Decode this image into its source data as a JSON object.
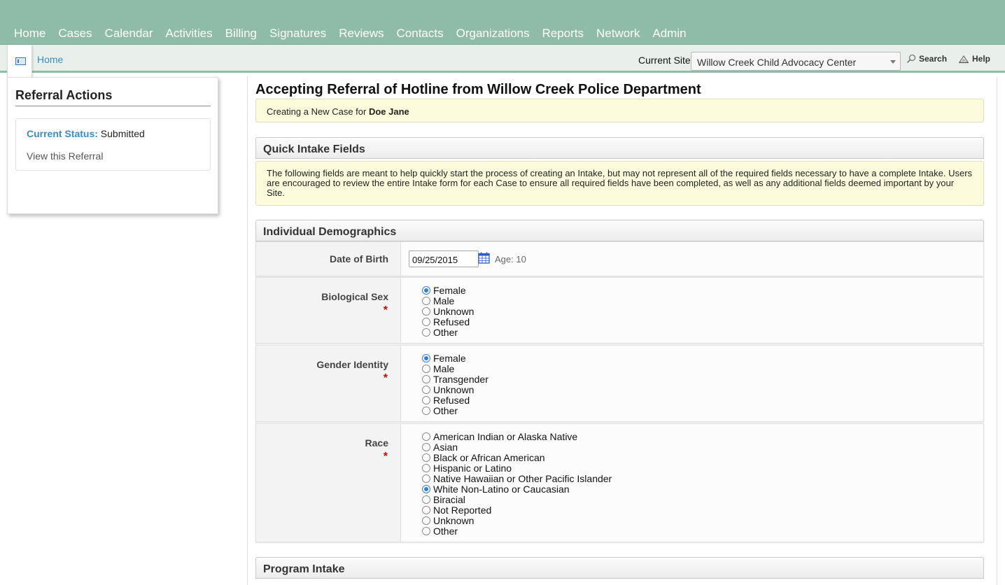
{
  "nav": {
    "items": [
      "Home",
      "Cases",
      "Calendar",
      "Activities",
      "Billing",
      "Signatures",
      "Reviews",
      "Contacts",
      "Organizations",
      "Reports",
      "Network",
      "Admin"
    ]
  },
  "subbar": {
    "breadcrumb": "Home",
    "site_label": "Current Site",
    "site_value": "Willow Creek Child Advocacy Center",
    "search_label": "Search",
    "help_label": "Help"
  },
  "sidebar": {
    "title": "Referral Actions",
    "status_key": "Current Status:",
    "status_value": "Submitted",
    "view_link": "View this Referral"
  },
  "main": {
    "title": "Accepting Referral of Hotline from Willow Creek Police Department",
    "creating_prefix": "Creating a New Case for",
    "creating_name": "Doe Jane",
    "quick_intake_title": "Quick Intake Fields",
    "quick_intake_note": "The following fields are meant to help quickly start the process of creating an Intake, but may not represent all of the required fields necessary to have a complete Intake. Users are encouraged to review the entire Intake form for each Case to ensure all required fields have been completed, as well as any additional fields deemed important by your Site.",
    "demographics_title": "Individual Demographics",
    "dob_label": "Date of Birth",
    "dob_value": "09/25/2015",
    "age_text": "Age: 10",
    "required_mark": "*",
    "bio_sex": {
      "label": "Biological Sex",
      "options": [
        "Female",
        "Male",
        "Unknown",
        "Refused",
        "Other"
      ],
      "selected": "Female"
    },
    "gender": {
      "label": "Gender Identity",
      "options": [
        "Female",
        "Male",
        "Transgender",
        "Unknown",
        "Refused",
        "Other"
      ],
      "selected": "Female"
    },
    "race": {
      "label": "Race",
      "options": [
        "American Indian or Alaska Native",
        "Asian",
        "Black or African American",
        "Hispanic or Latino",
        "Native Hawaiian or Other Pacific Islander",
        "White Non-Latino or Caucasian",
        "Biracial",
        "Not Reported",
        "Unknown",
        "Other"
      ],
      "selected": "White Non-Latino or Caucasian"
    },
    "program_intake_title": "Program Intake"
  },
  "colors": {
    "nav_bg": "#8fbca8",
    "link": "#3a8cc4",
    "note_bg": "#fcfcdc",
    "required": "#d40000",
    "radio_selected": "#2f7de1"
  }
}
